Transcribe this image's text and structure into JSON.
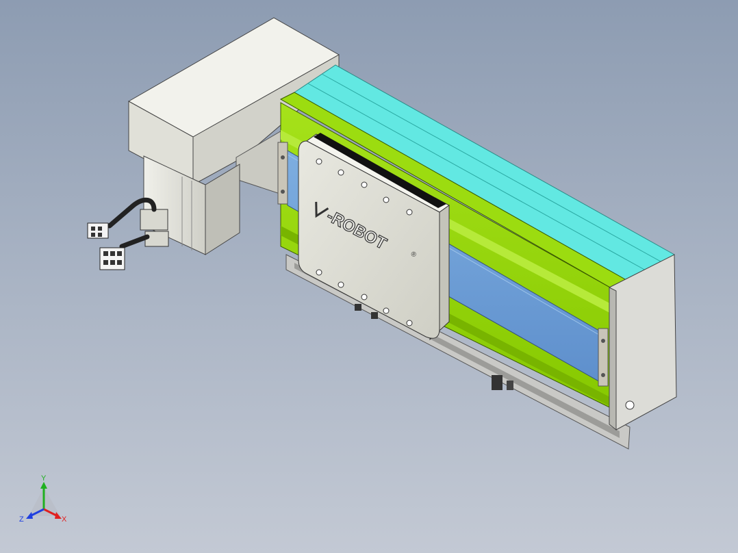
{
  "viewport": {
    "background_top": "#8d9cb2",
    "background_bottom": "#c3c9d4"
  },
  "model": {
    "logo_text": "-ROBOT",
    "logo_mark": "®",
    "colors": {
      "body": "#8fd400",
      "cover_strip": "#5fe8e0",
      "window": "#6f9fd8",
      "carriage": "#dcdcd2",
      "motor_housing": "#e6e6df",
      "end_plate": "#d9d9d4",
      "cable": "#222222"
    }
  },
  "triad": {
    "x_label": "X",
    "y_label": "Y",
    "z_label": "Z",
    "x_color": "#e02020",
    "y_color": "#20b020",
    "z_color": "#2040e0"
  }
}
